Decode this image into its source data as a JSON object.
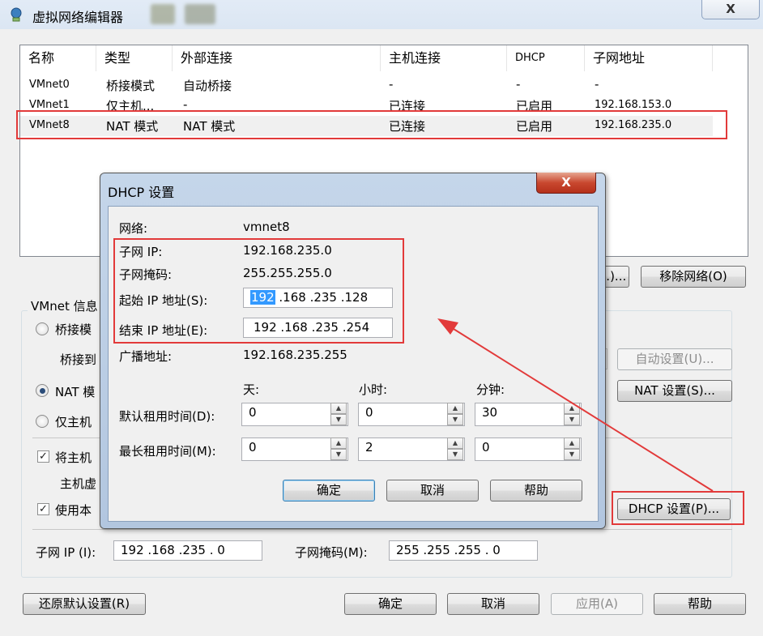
{
  "window": {
    "title": "虚拟网络编辑器",
    "close_label": "X"
  },
  "table": {
    "headers": [
      "名称",
      "类型",
      "外部连接",
      "主机连接",
      "DHCP",
      "子网地址"
    ],
    "rows": [
      {
        "name": "VMnet0",
        "type": "桥接模式",
        "external": "自动桥接",
        "host": "-",
        "dhcp": "-",
        "subnet": "-"
      },
      {
        "name": "VMnet1",
        "type": "仅主机...",
        "external": "-",
        "host": "已连接",
        "dhcp": "已启用",
        "subnet": "192.168.153.0"
      },
      {
        "name": "VMnet8",
        "type": "NAT 模式",
        "external": "NAT 模式",
        "host": "已连接",
        "dhcp": "已启用",
        "subnet": "192.168.235.0"
      }
    ]
  },
  "buttons": {
    "add_partial": "...)...",
    "remove_network": "移除网络(O)",
    "auto_settings": "自动设置(U)...",
    "nat_settings": "NAT 设置(S)...",
    "dhcp_settings": "DHCP 设置(P)...",
    "restore_defaults": "还原默认设置(R)",
    "ok": "确定",
    "cancel": "取消",
    "apply": "应用(A)",
    "help": "帮助"
  },
  "vmnet_info": {
    "group_label": "VMnet 信息",
    "bridge_radio": "桥接模",
    "bridge_to": "桥接到",
    "nat_radio": "NAT 模",
    "hostonly_radio": "仅主机",
    "connect_host_check": "将主机",
    "host_adapter": "主机虚",
    "use_dhcp_check": "使用本",
    "subnet_ip_label": "子网 IP (I):",
    "subnet_ip_value": "192 .168 .235 . 0",
    "subnet_mask_label": "子网掩码(M):",
    "subnet_mask_value": "255 .255 .255 . 0"
  },
  "dhcp_dialog": {
    "title": "DHCP 设置",
    "close_label": "X",
    "network_label": "网络:",
    "network_value": "vmnet8",
    "subnet_ip_label": "子网 IP:",
    "subnet_ip_value": "192.168.235.0",
    "mask_label": "子网掩码:",
    "mask_value": "255.255.255.0",
    "start_label": "起始 IP 地址(S):",
    "start_ip": {
      "o1": "192",
      "rest": " .168 .235 .128"
    },
    "end_label": "结束 IP 地址(E):",
    "end_ip": "192 .168 .235 .254",
    "broadcast_label": "广播地址:",
    "broadcast_value": "192.168.235.255",
    "col_days": "天:",
    "col_hours": "小时:",
    "col_minutes": "分钟:",
    "default_lease_label": "默认租用时间(D):",
    "default_lease": {
      "days": "0",
      "hours": "0",
      "minutes": "30"
    },
    "max_lease_label": "最长租用时间(M):",
    "max_lease": {
      "days": "0",
      "hours": "2",
      "minutes": "0"
    },
    "ok": "确定",
    "cancel": "取消",
    "help": "帮助"
  },
  "colors": {
    "highlight_box": "#e23a3a",
    "annotation_arrow": "#e23a3a"
  }
}
